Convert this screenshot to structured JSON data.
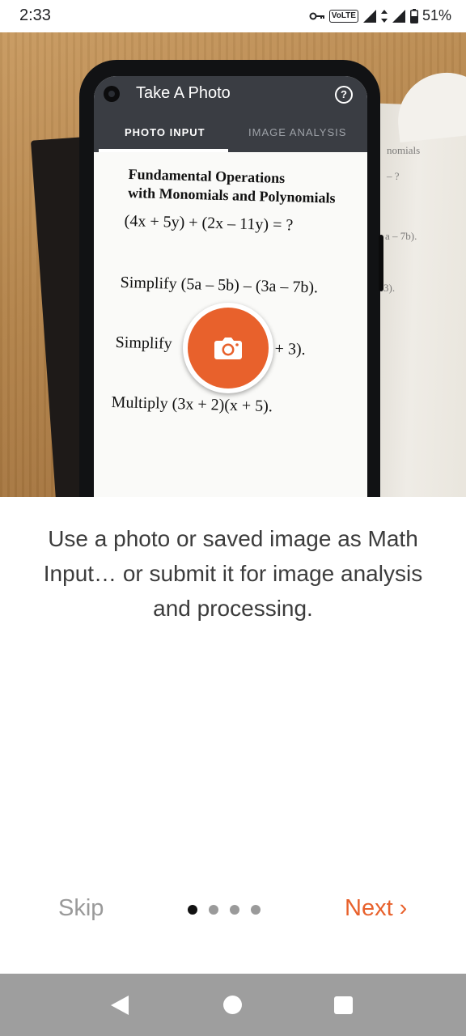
{
  "status_bar": {
    "time": "2:33",
    "volte": "VoLTE",
    "battery": "51%"
  },
  "phone_app": {
    "title": "Take A Photo",
    "tabs": [
      {
        "label": "PHOTO INPUT",
        "active": true
      },
      {
        "label": "IMAGE ANALYSIS",
        "active": false
      }
    ],
    "worksheet": {
      "heading_line1": "Fundamental Operations",
      "heading_line2": "with Monomials and Polynomials",
      "lines": [
        "(4x + 5y) + (2x – 11y) = ?",
        "Simplify (5a – 5b) – (3a – 7b).",
        "Simplify",
        "+ 3).",
        "Multiply (3x + 2)(x + 5)."
      ]
    },
    "background_book_text": [
      "nomials",
      "– ?",
      "a – 7b).",
      "3)."
    ]
  },
  "caption": "Use a photo or saved image as Math Input… or submit it for image analysis and processing.",
  "nav": {
    "skip_label": "Skip",
    "next_label": "Next ›",
    "page_count": 4,
    "active_page": 1
  },
  "colors": {
    "accent": "#e8612c",
    "app_bar": "#3a3d43",
    "caption_text": "#3c3c3c",
    "muted": "#9a9a9a",
    "system_nav": "#9e9e9e"
  }
}
